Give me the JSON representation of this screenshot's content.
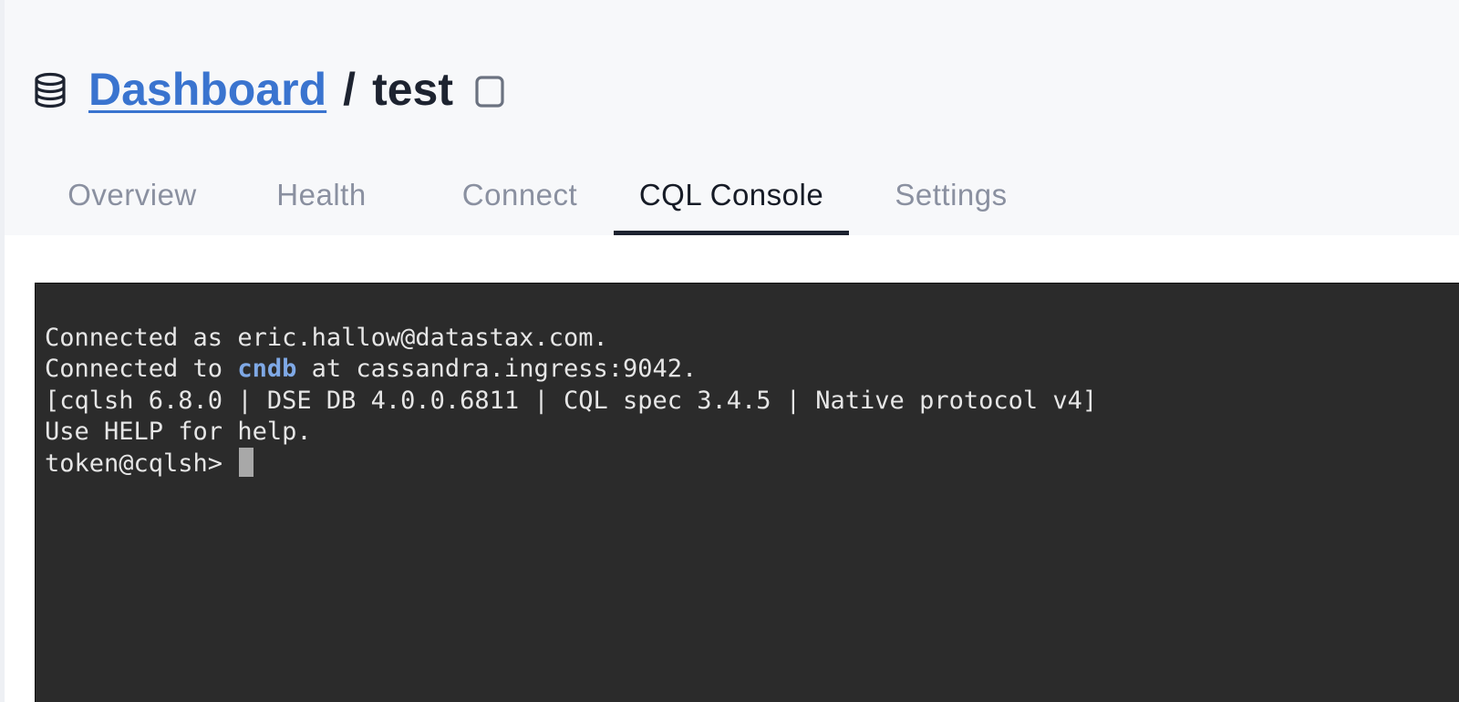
{
  "breadcrumb": {
    "root_label": "Dashboard",
    "separator": "/",
    "current": "test",
    "root_icon": "database-icon",
    "action_icon": "copy-icon"
  },
  "tabs": [
    {
      "label": "Overview",
      "active": false
    },
    {
      "label": "Health",
      "active": false
    },
    {
      "label": "Connect",
      "active": false
    },
    {
      "label": "CQL Console",
      "active": true
    },
    {
      "label": "Settings",
      "active": false
    }
  ],
  "terminal": {
    "line1": "Connected as eric.hallow@datastax.com.",
    "line2_prefix": "Connected to ",
    "line2_highlight": "cndb",
    "line2_suffix": " at cassandra.ingress:9042.",
    "line3": "[cqlsh 6.8.0 | DSE DB 4.0.0.6811 | CQL spec 3.4.5 | Native protocol v4]",
    "line4": "Use HELP for help.",
    "prompt": "token@cqlsh> "
  },
  "colors": {
    "link": "#3a74cf",
    "highlight": "#7fa9e6",
    "terminal_bg": "#2b2b2b",
    "header_bg": "#f7f8fa"
  }
}
